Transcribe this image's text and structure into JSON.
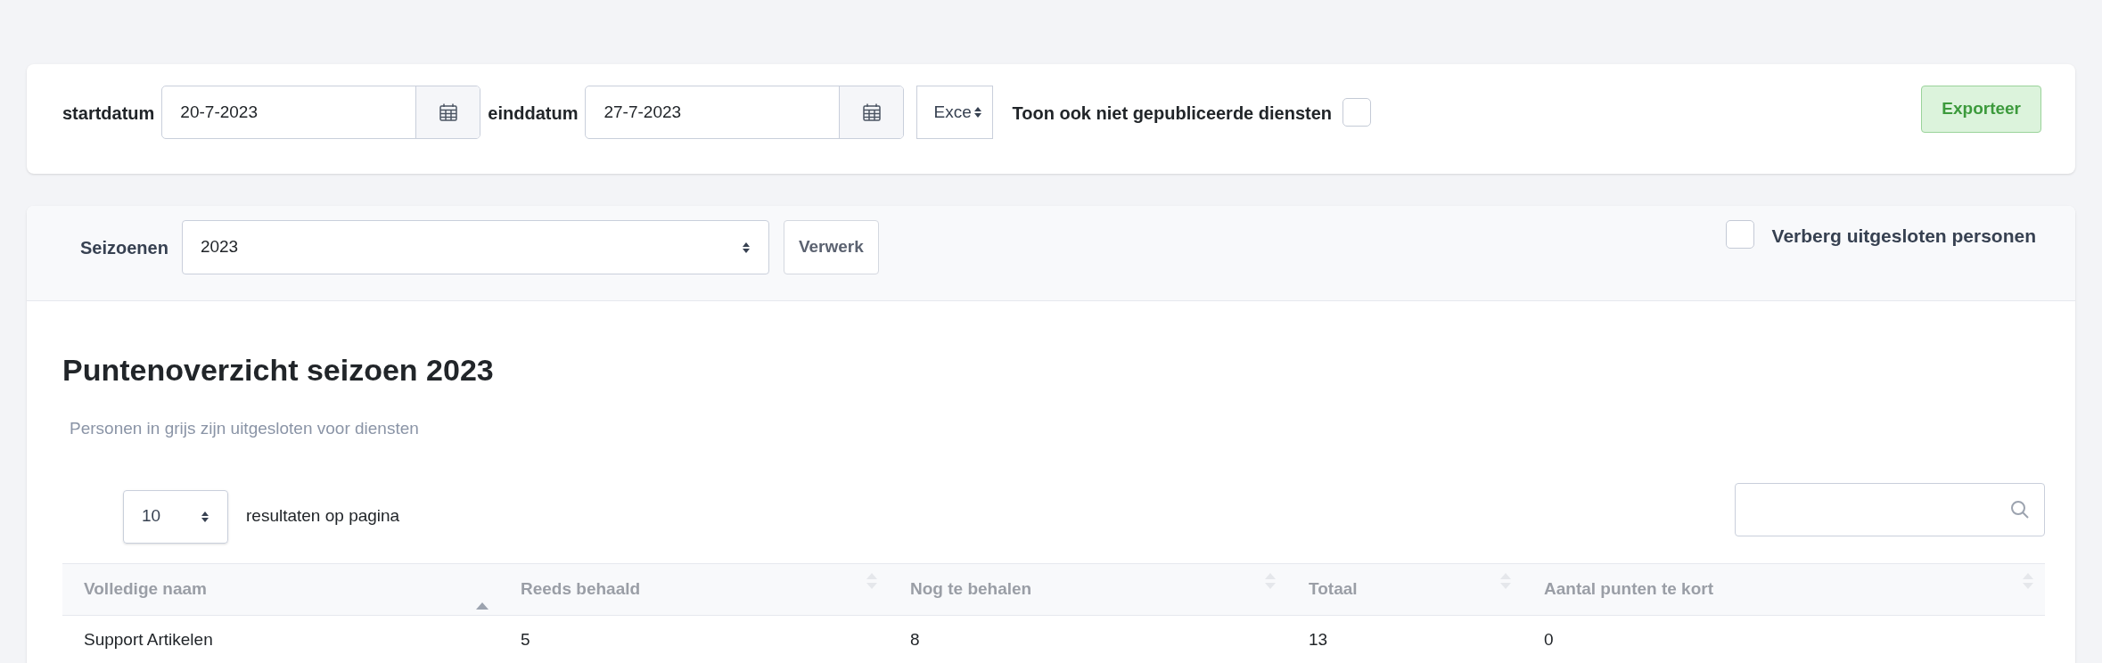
{
  "filters": {
    "start_label": "startdatum",
    "start_value": "20-7-2023",
    "end_label": "einddatum",
    "end_value": "27-7-2023",
    "format_value": "Exce",
    "unpublished_label": "Toon ook niet gepubliceerde diensten",
    "unpublished_checked": false,
    "export_button": "Exporteer"
  },
  "season": {
    "label": "Seizoenen",
    "value": "2023",
    "process_button": "Verwerk",
    "hide_excluded_label": "Verberg uitgesloten personen",
    "hide_excluded_checked": false
  },
  "title": "Puntenoverzicht seizoen 2023",
  "subtitle": "Personen in grijs zijn uitgesloten voor diensten",
  "page_size": {
    "value": "10",
    "label": "resultaten op pagina"
  },
  "table": {
    "columns": [
      {
        "label": "Volledige naam",
        "sorted": true
      },
      {
        "label": "Reeds behaald",
        "sorted": false
      },
      {
        "label": "Nog te behalen",
        "sorted": false
      },
      {
        "label": "Totaal",
        "sorted": false
      },
      {
        "label": "Aantal punten te kort",
        "sorted": false
      }
    ],
    "rows": [
      [
        "Support Artikelen",
        "5",
        "8",
        "13",
        "0"
      ]
    ]
  }
}
